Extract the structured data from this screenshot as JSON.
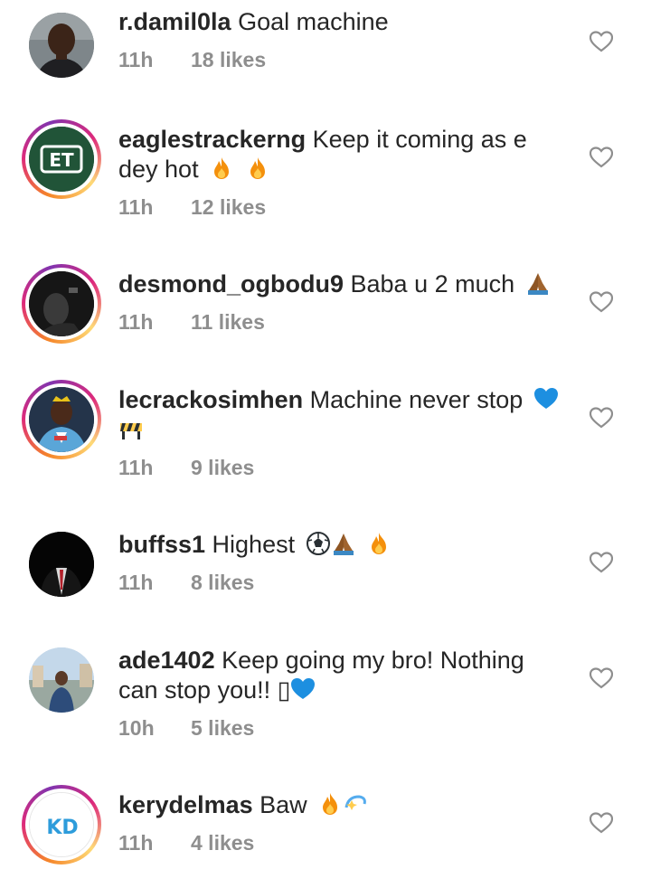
{
  "comments": [
    {
      "username": "r.damil0la",
      "text": "Goal machine",
      "time": "11h",
      "likes": "18 likes",
      "avatar_icon": "profile-photo-man"
    },
    {
      "username": "eaglestrackerng",
      "text": "Keep it coming as e dey hot",
      "emoji": [
        "fire-emoji",
        "fire-emoji"
      ],
      "time": "11h",
      "likes": "12 likes",
      "avatar_icon": "et-logo",
      "avatar_label": "ET"
    },
    {
      "username": "desmond_ogbodu9",
      "text": "Baba u 2 much",
      "emoji": [
        "folded-hands-emoji"
      ],
      "time": "11h",
      "likes": "11 likes",
      "avatar_icon": "profile-photo-dark"
    },
    {
      "username": "lecrackosimhen",
      "text": "Machine never stop",
      "emoji": [
        "blue-heart-emoji",
        "construction-emoji"
      ],
      "time": "11h",
      "likes": "9 likes",
      "avatar_icon": "profile-photo-footballer"
    },
    {
      "username": "buffss1",
      "text": "Highest",
      "emoji": [
        "soccer-ball-emoji",
        "folded-hands-emoji",
        "fire-emoji"
      ],
      "time": "11h",
      "likes": "8 likes",
      "avatar_icon": "profile-photo-suit"
    },
    {
      "username": "ade1402",
      "text": "Keep going my bro! Nothing can stop you!! ▯",
      "emoji": [
        "blue-heart-emoji"
      ],
      "time": "10h",
      "likes": "5 likes",
      "avatar_icon": "profile-photo-outdoor"
    },
    {
      "username": "kerydelmas",
      "text": "Baw",
      "emoji": [
        "fire-emoji",
        "dizzy-emoji"
      ],
      "time": "11h",
      "likes": "4 likes",
      "avatar_icon": "kd-logo",
      "avatar_label": "KD"
    }
  ],
  "colors": {
    "text": "#262626",
    "meta": "#8e8e8e",
    "ring_start": "#f58529",
    "ring_end": "#dd2a7b"
  }
}
